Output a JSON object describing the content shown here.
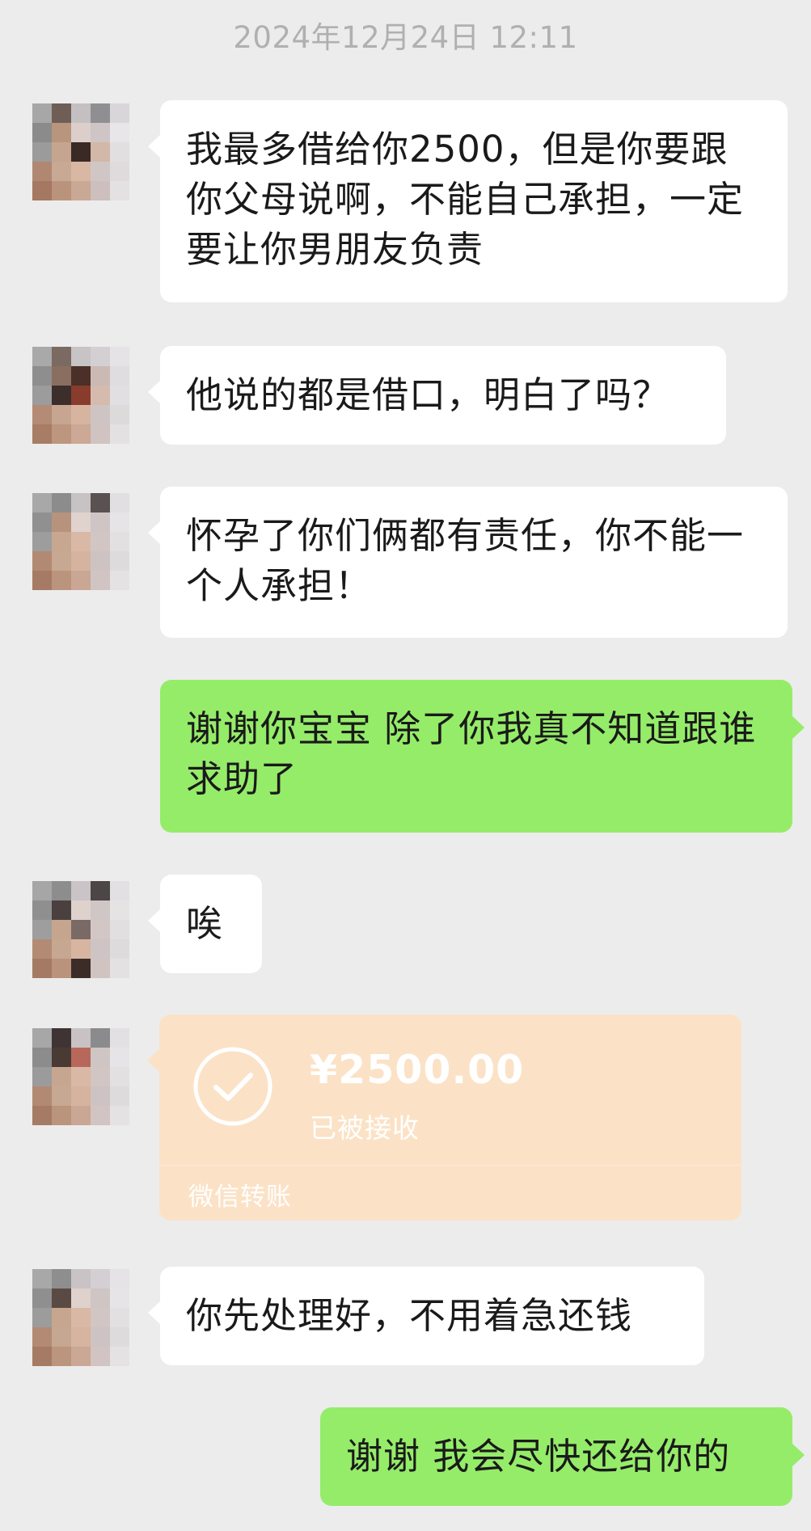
{
  "chat": {
    "timestamp": "2024年12月24日 12:11",
    "messages": [
      {
        "side": "left",
        "text": "我最多借给你2500，但是你要跟你父母说啊，不能自己承担，一定要让你男朋友负责"
      },
      {
        "side": "left",
        "text": "他说的都是借口，明白了吗？"
      },
      {
        "side": "left",
        "text": "怀孕了你们俩都有责任，你不能一个人承担！"
      },
      {
        "side": "right",
        "text": "谢谢你宝宝 除了你我真不知道跟谁求助了"
      },
      {
        "side": "left",
        "text": "唉"
      },
      {
        "side": "left",
        "type": "transfer",
        "amount": "¥2500.00",
        "status": "已被接收",
        "footer": "微信转账",
        "icon": "check-circle-icon"
      },
      {
        "side": "left",
        "text": "你先处理好，不用着急还钱"
      },
      {
        "side": "right",
        "text": "谢谢 我会尽快还给你的"
      }
    ]
  },
  "colors": {
    "background": "#ececec",
    "incoming_bubble": "#ffffff",
    "outgoing_bubble": "#95ec69",
    "transfer_bubble": "#fbe2c6"
  }
}
